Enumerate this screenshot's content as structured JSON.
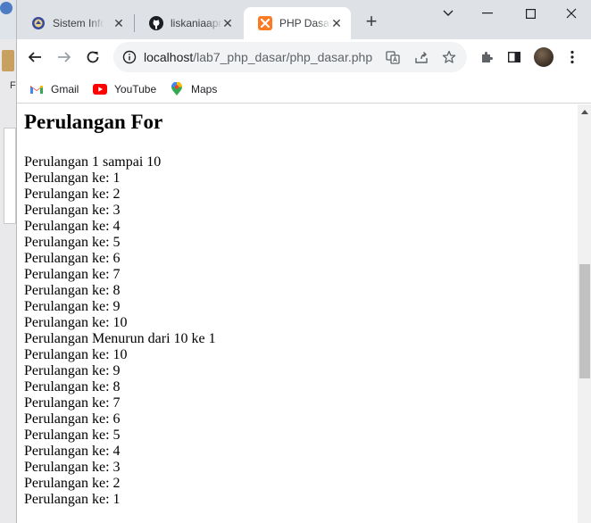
{
  "desktop": {
    "label": "F"
  },
  "tabs": [
    {
      "title": "Sistem Informasi",
      "active": false
    },
    {
      "title": "liskaniaaprilia",
      "active": false
    },
    {
      "title": "PHP Dasar",
      "active": true
    }
  ],
  "toolbar": {
    "url_host": "localhost",
    "url_path": "/lab7_php_dasar/php_dasar.php"
  },
  "bookmarks": [
    {
      "label": "Gmail"
    },
    {
      "label": "YouTube"
    },
    {
      "label": "Maps"
    }
  ],
  "page": {
    "heading": "Perulangan For",
    "lines": [
      "Perulangan 1 sampai 10",
      "Perulangan ke: 1",
      "Perulangan ke: 2",
      "Perulangan ke: 3",
      "Perulangan ke: 4",
      "Perulangan ke: 5",
      "Perulangan ke: 6",
      "Perulangan ke: 7",
      "Perulangan ke: 8",
      "Perulangan ke: 9",
      "Perulangan ke: 10",
      "Perulangan Menurun dari 10 ke 1",
      "Perulangan ke: 10",
      "Perulangan ke: 9",
      "Perulangan ke: 8",
      "Perulangan ke: 7",
      "Perulangan ke: 6",
      "Perulangan ke: 5",
      "Perulangan ke: 4",
      "Perulangan ke: 3",
      "Perulangan ke: 2",
      "Perulangan ke: 1"
    ]
  },
  "colors": {
    "tabstrip": "#dee1e6",
    "active_tab": "#ffffff",
    "xampp_orange": "#fb7a24",
    "youtube_red": "#ff0000"
  }
}
